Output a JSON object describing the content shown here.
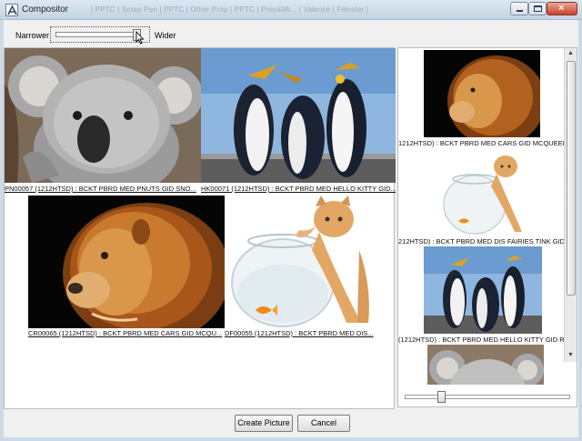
{
  "window": {
    "title": "Compositor",
    "ghost_menu": "| PPTC | Scrap Pen | PPTC | Other Prop | PPTC | Prop&Mi.., | Valence | Filmster |"
  },
  "toolbar": {
    "narrower_label": "Narrower",
    "wider_label": "Wider"
  },
  "left_tiles": [
    {
      "caption": "PN00057 (1212HTSD) : BCKT PBRD MED PNUTS GID SNO...",
      "image": "koala"
    },
    {
      "caption": "HK00071 (1212HTSD) : BCKT PBRD MED HELLO KITTY GID...",
      "image": "penguins"
    },
    {
      "caption": "CR00065 (1212HTSD) : BCKT PBRD MED CARS GID MCQU...",
      "image": "lion"
    },
    {
      "caption": "DF00055 (1212HTSD) : BCKT PBRD MED DIS...",
      "image": "kitten-fishbowl"
    }
  ],
  "right_tiles": [
    {
      "caption": "1212HTSD) : BCKT PBRD MED CARS GID MCQUEEN",
      "image": "lion"
    },
    {
      "caption": "212HTSD) : BCKT PBRD MED DIS FAIRIES TINK GID",
      "image": "kitten-fishbowl"
    },
    {
      "caption": "(1212HTSD) : BCKT PBRD MED HELLO KITTY GID R",
      "image": "penguins"
    },
    {
      "caption": "",
      "image": "koala"
    }
  ],
  "buttons": {
    "create": "Create Picture",
    "cancel": "Cancel"
  }
}
